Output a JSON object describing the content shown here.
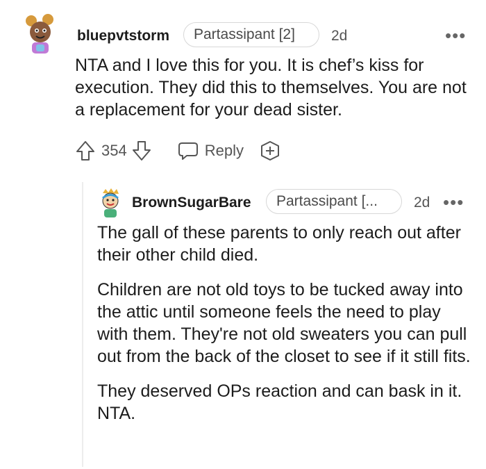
{
  "comments": [
    {
      "username": "bluepvtstorm",
      "flair": "Partassipant [2]",
      "time": "2d",
      "more": "•••",
      "body": [
        "NTA and I love this for you. It is chef’s kiss for execution. They did this to themselves. You are not a replacement for your dead sister."
      ],
      "votes": "354",
      "reply_label": "Reply"
    },
    {
      "username": "BrownSugarBare",
      "flair": "Partassipant [...",
      "time": "2d",
      "more": "•••",
      "body": [
        "The gall of these parents to only reach out after their other child died.",
        "Children are not old toys to be tucked away into the attic until someone feels the need to play with them. They're not old sweaters you can pull out from the back of the closet to see if it still fits.",
        "They deserved OPs reaction and can bask in it. NTA."
      ]
    }
  ],
  "colors": {
    "text": "#1c1c1c",
    "muted": "#555555",
    "border": "#d7d7d7"
  },
  "icons": [
    "upvote-icon",
    "downvote-icon",
    "reply-icon",
    "award-icon",
    "more-icon"
  ]
}
